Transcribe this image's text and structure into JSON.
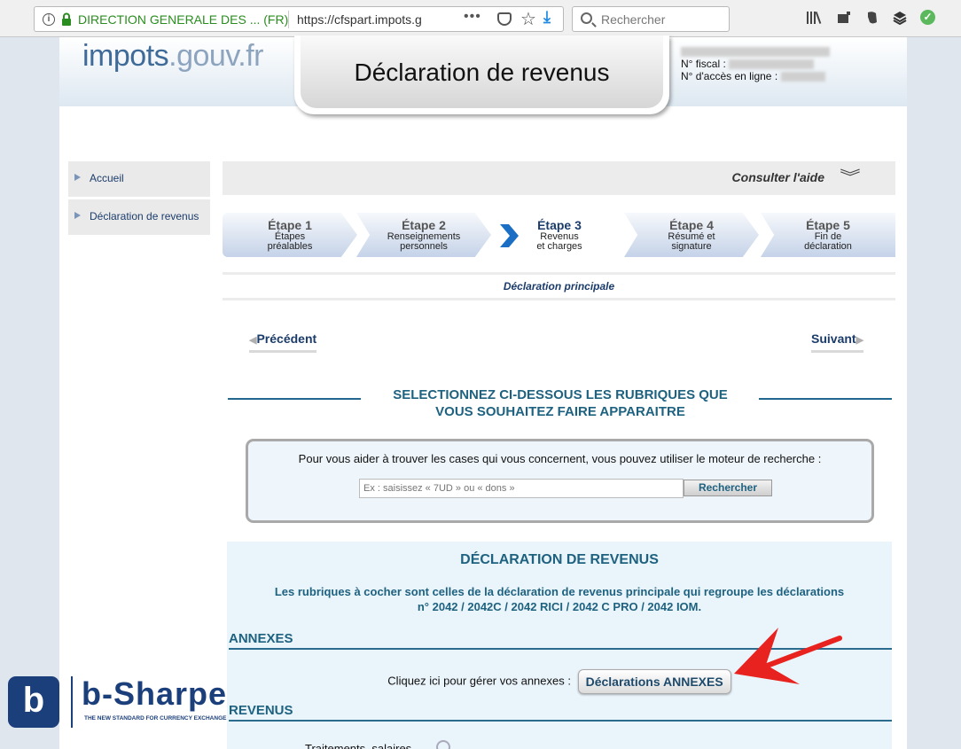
{
  "browser": {
    "site_identity": "DIRECTION GENERALE DES ... (FR)",
    "url": "https://cfspart.impots.g",
    "menu_dots": "•••",
    "search_placeholder": "Rechercher"
  },
  "header": {
    "logo_main": "impots",
    "logo_dot": ".gouv.fr",
    "title": "Déclaration de revenus",
    "fiscal_label": "N° fiscal :",
    "access_label": "N° d'accès en ligne :"
  },
  "sidebar": {
    "items": [
      {
        "label": "Accueil"
      },
      {
        "label": "Déclaration de revenus"
      }
    ]
  },
  "help": {
    "label": "Consulter l'aide"
  },
  "steps": [
    {
      "title": "Étape 1",
      "line1": "Étapes",
      "line2": "préalables",
      "active": false
    },
    {
      "title": "Étape 2",
      "line1": "Renseignements",
      "line2": "personnels",
      "active": false
    },
    {
      "title": "Étape 3",
      "line1": "Revenus",
      "line2": "et charges",
      "active": true
    },
    {
      "title": "Étape 4",
      "line1": "Résumé et",
      "line2": "signature",
      "active": false
    },
    {
      "title": "Étape 5",
      "line1": "Fin de",
      "line2": "déclaration",
      "active": false
    }
  ],
  "subtitle": "Déclaration principale",
  "nav": {
    "prev": "Précédent",
    "next": "Suivant"
  },
  "section": {
    "line1": "SELECTIONNEZ CI-DESSOUS LES RUBRIQUES QUE",
    "line2": "VOUS SOUHAITEZ FAIRE APPARAITRE"
  },
  "search": {
    "help": "Pour vous aider à trouver les cases qui vous concernent, vous pouvez utiliser le moteur de recherche :",
    "placeholder": "Ex : saisissez « 7UD » ou « dons »",
    "button": "Rechercher"
  },
  "declaration": {
    "title": "DÉCLARATION DE REVENUS",
    "desc_line1": "Les rubriques à cocher sont celles de la déclaration de revenus principale qui regroupe les déclarations",
    "desc_line2": "n° 2042 / 2042C / 2042 RICI / 2042 C PRO / 2042 IOM.",
    "annexes_heading": "ANNEXES",
    "annexes_prompt": "Cliquez ici pour gérer vos annexes :",
    "annexes_button": "Déclarations ANNEXES",
    "revenus_heading": "REVENUS",
    "revenus_item": "Traitements, salaires"
  },
  "watermark": {
    "brand": "b-Sharpe",
    "glyph": "b",
    "tagline": "THE NEW STANDARD FOR CURRENCY EXCHANGE"
  },
  "colors": {
    "brand_blue": "#1e6280",
    "navy": "#1b3c6b",
    "annotation_red": "#e8231f"
  }
}
